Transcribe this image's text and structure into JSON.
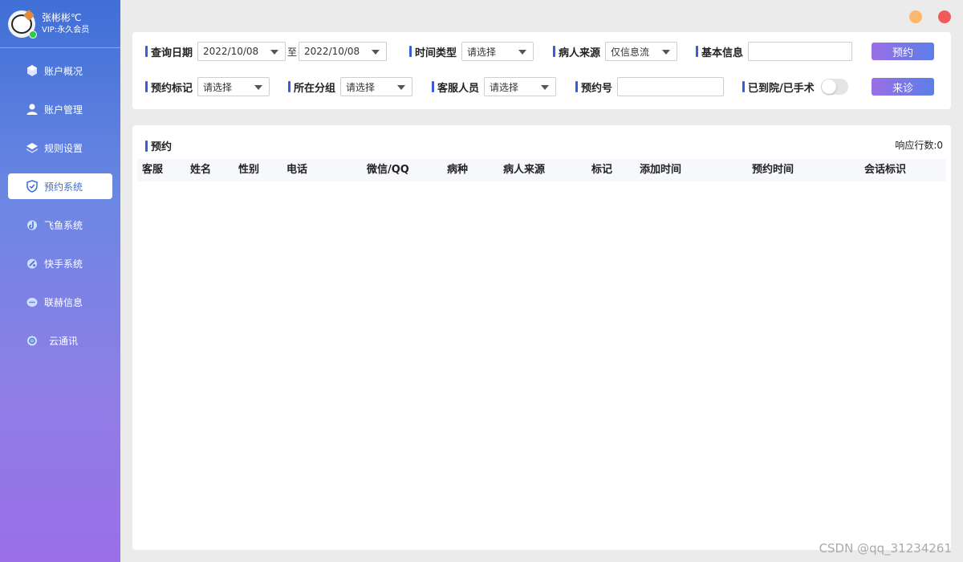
{
  "user": {
    "name": "张彬彬℃",
    "vip": "VIP:永久会员"
  },
  "nav": [
    {
      "label": "账户概况",
      "icon": "cube-icon",
      "active": false
    },
    {
      "label": "账户管理",
      "icon": "user-icon",
      "active": false
    },
    {
      "label": "规则设置",
      "icon": "layers-icon",
      "active": false
    },
    {
      "label": "预约系统",
      "icon": "shield-icon",
      "active": true
    },
    {
      "label": "飞鱼系统",
      "icon": "fish-icon",
      "active": false
    },
    {
      "label": "快手系统",
      "icon": "kuaishou-icon",
      "active": false
    },
    {
      "label": "联赫信息",
      "icon": "chat-icon",
      "active": false
    },
    {
      "label": "云通讯",
      "icon": "cloud-phone-icon",
      "active": false
    }
  ],
  "filters": {
    "query_date_label": "查询日期",
    "date_from": "2022/10/08",
    "date_to_sep": "至",
    "date_to": "2022/10/08",
    "time_type_label": "时间类型",
    "time_type_value": "请选择",
    "source_label": "病人来源",
    "source_value": "仅信息流",
    "basic_info_label": "基本信息",
    "basic_info_value": "",
    "appoint_button": "预约",
    "mark_label": "预约标记",
    "mark_value": "请选择",
    "group_label": "所在分组",
    "group_value": "请选择",
    "staff_label": "客服人员",
    "staff_value": "请选择",
    "appoint_no_label": "预约号",
    "appoint_no_value": "",
    "arrived_label": "已到院/已手术",
    "arrived_toggle": false,
    "visit_button": "来诊"
  },
  "result": {
    "title": "预约",
    "row_count": "响应行数:0",
    "columns": [
      "客服",
      "姓名",
      "性别",
      "电话",
      "微信/QQ",
      "病种",
      "病人来源",
      "标记",
      "添加时间",
      "预约时间",
      "会话标识"
    ],
    "rows": []
  },
  "watermark": "CSDN @qq_31234261",
  "colors": {
    "accent": "#3b5bdb",
    "nav_active_text": "#3b6fd8",
    "minimize": "#fdb86d",
    "close": "#f25a5a"
  }
}
